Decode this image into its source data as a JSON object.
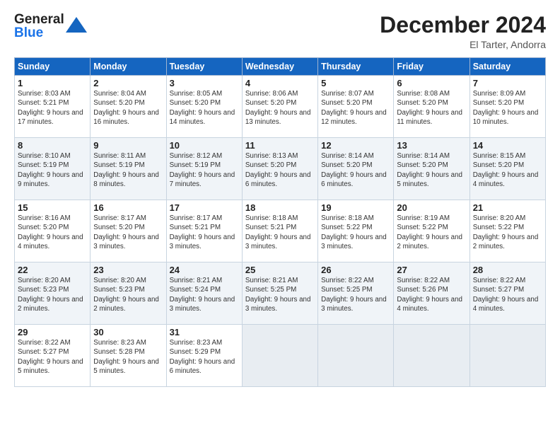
{
  "header": {
    "logo_general": "General",
    "logo_blue": "Blue",
    "month_title": "December 2024",
    "location": "El Tarter, Andorra"
  },
  "weekdays": [
    "Sunday",
    "Monday",
    "Tuesday",
    "Wednesday",
    "Thursday",
    "Friday",
    "Saturday"
  ],
  "weeks": [
    [
      {
        "day": "1",
        "sunrise": "8:03 AM",
        "sunset": "5:21 PM",
        "daylight": "9 hours and 17 minutes."
      },
      {
        "day": "2",
        "sunrise": "8:04 AM",
        "sunset": "5:20 PM",
        "daylight": "9 hours and 16 minutes."
      },
      {
        "day": "3",
        "sunrise": "8:05 AM",
        "sunset": "5:20 PM",
        "daylight": "9 hours and 14 minutes."
      },
      {
        "day": "4",
        "sunrise": "8:06 AM",
        "sunset": "5:20 PM",
        "daylight": "9 hours and 13 minutes."
      },
      {
        "day": "5",
        "sunrise": "8:07 AM",
        "sunset": "5:20 PM",
        "daylight": "9 hours and 12 minutes."
      },
      {
        "day": "6",
        "sunrise": "8:08 AM",
        "sunset": "5:20 PM",
        "daylight": "9 hours and 11 minutes."
      },
      {
        "day": "7",
        "sunrise": "8:09 AM",
        "sunset": "5:20 PM",
        "daylight": "9 hours and 10 minutes."
      }
    ],
    [
      {
        "day": "8",
        "sunrise": "8:10 AM",
        "sunset": "5:19 PM",
        "daylight": "9 hours and 9 minutes."
      },
      {
        "day": "9",
        "sunrise": "8:11 AM",
        "sunset": "5:19 PM",
        "daylight": "9 hours and 8 minutes."
      },
      {
        "day": "10",
        "sunrise": "8:12 AM",
        "sunset": "5:19 PM",
        "daylight": "9 hours and 7 minutes."
      },
      {
        "day": "11",
        "sunrise": "8:13 AM",
        "sunset": "5:20 PM",
        "daylight": "9 hours and 6 minutes."
      },
      {
        "day": "12",
        "sunrise": "8:14 AM",
        "sunset": "5:20 PM",
        "daylight": "9 hours and 6 minutes."
      },
      {
        "day": "13",
        "sunrise": "8:14 AM",
        "sunset": "5:20 PM",
        "daylight": "9 hours and 5 minutes."
      },
      {
        "day": "14",
        "sunrise": "8:15 AM",
        "sunset": "5:20 PM",
        "daylight": "9 hours and 4 minutes."
      }
    ],
    [
      {
        "day": "15",
        "sunrise": "8:16 AM",
        "sunset": "5:20 PM",
        "daylight": "9 hours and 4 minutes."
      },
      {
        "day": "16",
        "sunrise": "8:17 AM",
        "sunset": "5:20 PM",
        "daylight": "9 hours and 3 minutes."
      },
      {
        "day": "17",
        "sunrise": "8:17 AM",
        "sunset": "5:21 PM",
        "daylight": "9 hours and 3 minutes."
      },
      {
        "day": "18",
        "sunrise": "8:18 AM",
        "sunset": "5:21 PM",
        "daylight": "9 hours and 3 minutes."
      },
      {
        "day": "19",
        "sunrise": "8:18 AM",
        "sunset": "5:22 PM",
        "daylight": "9 hours and 3 minutes."
      },
      {
        "day": "20",
        "sunrise": "8:19 AM",
        "sunset": "5:22 PM",
        "daylight": "9 hours and 2 minutes."
      },
      {
        "day": "21",
        "sunrise": "8:20 AM",
        "sunset": "5:22 PM",
        "daylight": "9 hours and 2 minutes."
      }
    ],
    [
      {
        "day": "22",
        "sunrise": "8:20 AM",
        "sunset": "5:23 PM",
        "daylight": "9 hours and 2 minutes."
      },
      {
        "day": "23",
        "sunrise": "8:20 AM",
        "sunset": "5:23 PM",
        "daylight": "9 hours and 2 minutes."
      },
      {
        "day": "24",
        "sunrise": "8:21 AM",
        "sunset": "5:24 PM",
        "daylight": "9 hours and 3 minutes."
      },
      {
        "day": "25",
        "sunrise": "8:21 AM",
        "sunset": "5:25 PM",
        "daylight": "9 hours and 3 minutes."
      },
      {
        "day": "26",
        "sunrise": "8:22 AM",
        "sunset": "5:25 PM",
        "daylight": "9 hours and 3 minutes."
      },
      {
        "day": "27",
        "sunrise": "8:22 AM",
        "sunset": "5:26 PM",
        "daylight": "9 hours and 4 minutes."
      },
      {
        "day": "28",
        "sunrise": "8:22 AM",
        "sunset": "5:27 PM",
        "daylight": "9 hours and 4 minutes."
      }
    ],
    [
      {
        "day": "29",
        "sunrise": "8:22 AM",
        "sunset": "5:27 PM",
        "daylight": "9 hours and 5 minutes."
      },
      {
        "day": "30",
        "sunrise": "8:23 AM",
        "sunset": "5:28 PM",
        "daylight": "9 hours and 5 minutes."
      },
      {
        "day": "31",
        "sunrise": "8:23 AM",
        "sunset": "5:29 PM",
        "daylight": "9 hours and 6 minutes."
      },
      null,
      null,
      null,
      null
    ]
  ],
  "labels": {
    "sunrise": "Sunrise:",
    "sunset": "Sunset:",
    "daylight": "Daylight:"
  }
}
